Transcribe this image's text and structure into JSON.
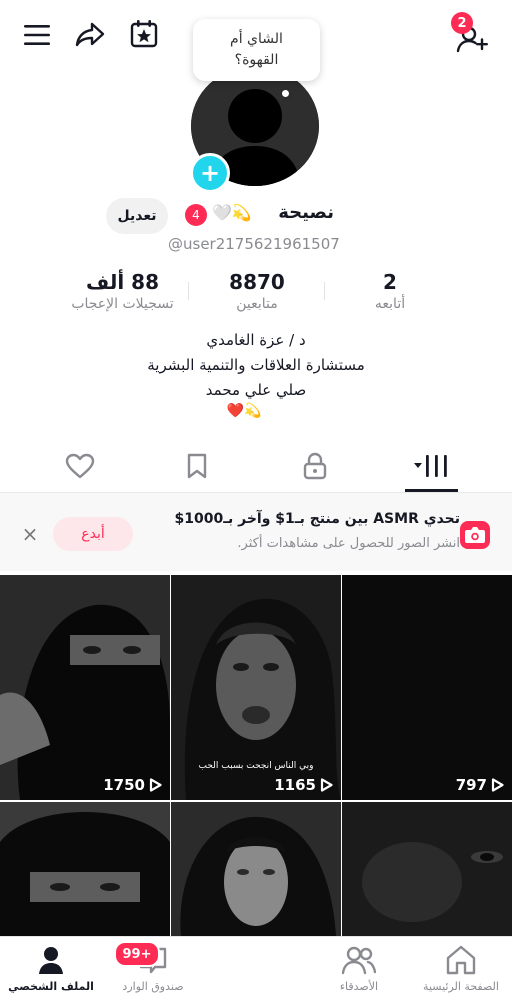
{
  "header": {
    "follow_badge": "2",
    "bubble_text": "الشاي أم القهوة؟"
  },
  "profile": {
    "name": "نصيحة",
    "name_emoji": "🤍💫",
    "notification_count": "4",
    "edit_label": "تعديل",
    "username": "@user2175621961507",
    "stats": {
      "following_count": "2",
      "following_label": "أتابعه",
      "followers_count": "8870",
      "followers_label": "متابعين",
      "likes_count": "88 ألف",
      "likes_label": "تسجيلات الإعجاب"
    },
    "bio": {
      "line1": "د / عزة الغامدي",
      "line2": "مستشارة العلاقات والتنمية البشرية",
      "line3": "صلي علي محمد",
      "line4": "💫❤️"
    }
  },
  "tabs": {
    "active": "videos",
    "items": [
      "videos",
      "private",
      "saved",
      "liked"
    ]
  },
  "challenge": {
    "title": "تحدي ASMR بين منتج بـ1$ وآخر بـ1000$",
    "subtitle": "انشر الصور للحصول على مشاهدات أكثر.",
    "button_label": "أبدع",
    "close_label": "×"
  },
  "videos": [
    {
      "views": "797"
    },
    {
      "views": "1165",
      "caption": "وبي الناس انجحت بسبب الحب"
    },
    {
      "views": "1750"
    },
    {
      "views": ""
    },
    {
      "views": ""
    },
    {
      "views": ""
    }
  ],
  "bottom_nav": {
    "home": "الصفحة الرئيسية",
    "friends": "الأصدقاء",
    "inbox": "صندوق الوارد",
    "inbox_badge": "99+",
    "profile": "الملف الشخصي"
  },
  "colors": {
    "accent": "#fe2c55",
    "cyan": "#20d5ec",
    "text": "#161823",
    "muted": "#8a8b91"
  },
  "icons": [
    "menu-icon",
    "share-icon",
    "calendar-star-icon",
    "add-friend-icon",
    "heart-icon",
    "bookmark-icon",
    "lock-icon",
    "grid-icon",
    "camera-icon",
    "home-icon",
    "friends-icon",
    "inbox-icon",
    "profile-icon",
    "play-icon"
  ]
}
